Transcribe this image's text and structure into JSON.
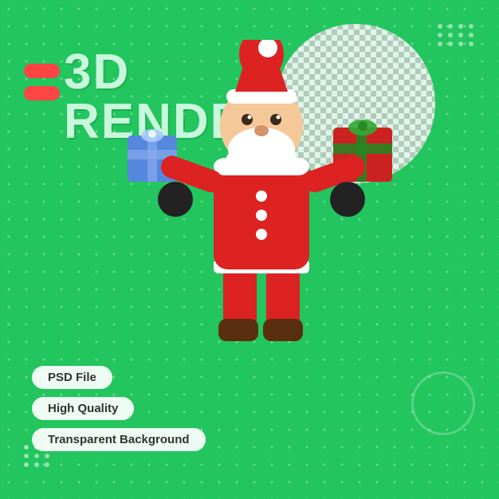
{
  "page": {
    "background_color": "#22c55e",
    "title_line1": "3D",
    "title_line2": "RENDER",
    "badges": [
      {
        "label": "PSD File"
      },
      {
        "label": "High Quality"
      },
      {
        "label": "Transparent Background"
      }
    ],
    "dots_top_right_count": 12,
    "dots_bottom_left_count": 9,
    "red_bars_count": 2,
    "circle_checker": true,
    "circle_bottom_right": true
  }
}
